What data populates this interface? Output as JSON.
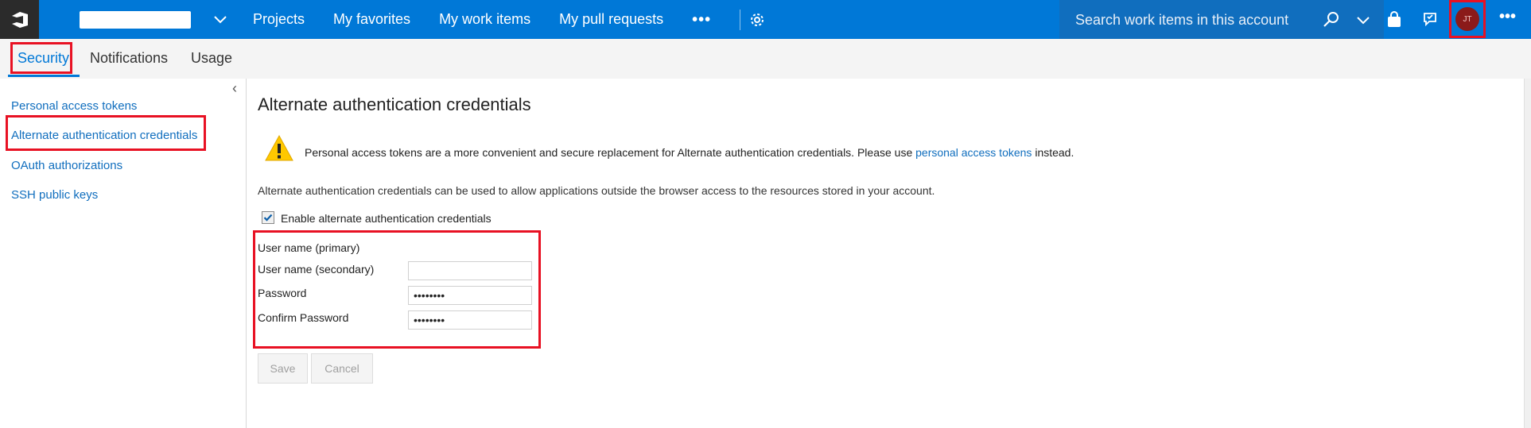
{
  "topbar": {
    "nav": [
      {
        "label": "Projects"
      },
      {
        "label": "My favorites"
      },
      {
        "label": "My work items"
      },
      {
        "label": "My pull requests"
      }
    ],
    "more_label": "•••",
    "search": {
      "placeholder": "Search work items in this account"
    },
    "avatar_initials": "JT",
    "overflow_label": "•••",
    "colors": {
      "bar": "#0078d7",
      "search_bg": "#106ebe",
      "highlight": "#e81123"
    }
  },
  "subtabs": [
    {
      "label": "Security",
      "active": true
    },
    {
      "label": "Notifications"
    },
    {
      "label": "Usage"
    }
  ],
  "sidebar": {
    "collapse_glyph": "‹",
    "items": [
      {
        "label": "Personal access tokens"
      },
      {
        "label": "Alternate authentication credentials",
        "selected": true
      },
      {
        "label": "OAuth authorizations"
      },
      {
        "label": "SSH public keys"
      }
    ]
  },
  "main": {
    "title": "Alternate authentication credentials",
    "warning": {
      "text_before": "Personal access tokens are a more convenient and secure replacement for Alternate authentication credentials. Please use ",
      "link": "personal access tokens",
      "text_after": " instead."
    },
    "description": "Alternate authentication credentials can be used to allow applications outside the browser access to the resources stored in your account.",
    "enable_checkbox": {
      "label": "Enable alternate authentication credentials",
      "checked": true
    },
    "fields": {
      "primary_label": "User name (primary)",
      "secondary_label": "User name (secondary)",
      "secondary_value": "",
      "password_label": "Password",
      "password_value": "••••••••",
      "confirm_label": "Confirm Password",
      "confirm_value": "••••••••"
    },
    "buttons": {
      "save": "Save",
      "cancel": "Cancel"
    }
  }
}
